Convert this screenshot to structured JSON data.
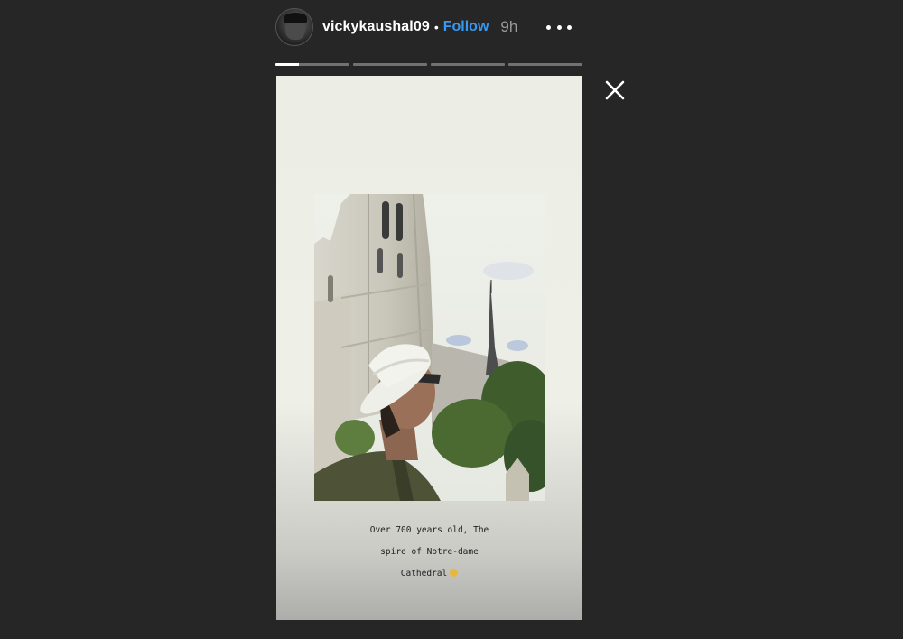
{
  "header": {
    "username": "vickykaushal09",
    "separator": "•",
    "follow_label": "Follow",
    "time_ago": "9h",
    "more_icon": "more-horizontal-icon",
    "avatar_icon": "profile-avatar"
  },
  "progress": {
    "segments": 4,
    "current_index": 0,
    "current_fraction": 0.32
  },
  "close_icon": "close-icon",
  "story": {
    "caption_line1": "Over 700 years old, The",
    "caption_line2": "spire of Notre-dame",
    "caption_line3": "Cathedral",
    "caption_emoji": "smiling-face-emoji"
  },
  "colors": {
    "background": "#262626",
    "follow": "#3897f0",
    "username": "#ffffff",
    "time": "#9a9a9a"
  }
}
